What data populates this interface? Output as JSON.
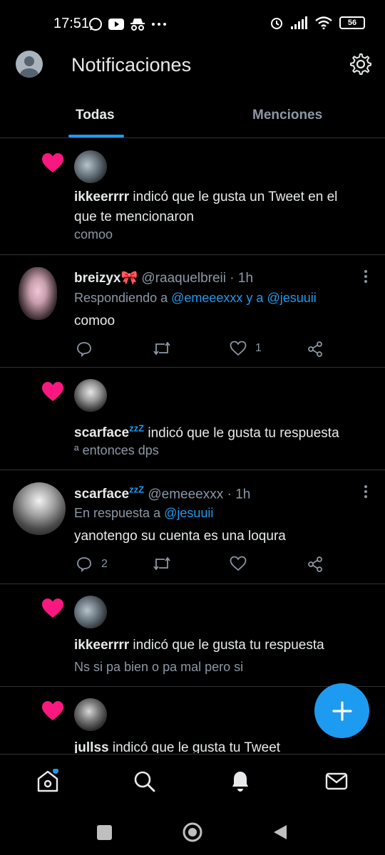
{
  "status": {
    "time": "17:51",
    "battery": "56"
  },
  "header": {
    "title": "Notificaciones"
  },
  "tabs": {
    "all": "Todas",
    "mentions": "Menciones"
  },
  "notifications": [
    {
      "type": "like",
      "user": "ikkeerrrr",
      "action": " indicó que le gusta un Tweet en el que te mencionaron",
      "snippet": "comoo"
    },
    {
      "type": "tweet",
      "name": "breizyx🎀",
      "handle": "@raaquelbreii · 1h",
      "reply_prefix": "Respondiendo a ",
      "reply_user1": "@emeeexxx",
      "reply_and": " y a ",
      "reply_user2": "@jesuuii",
      "text": "comoo",
      "likes": "1"
    },
    {
      "type": "like",
      "user": "scarface",
      "user_zz": "zzZ",
      "action": " indicó que le gusta tu respuesta",
      "snippet": "ª entonces dps"
    },
    {
      "type": "tweet",
      "name": "scarface",
      "name_zz": "zzZ",
      "handle": "@emeeexxx · 1h",
      "reply_prefix": "En respuesta a ",
      "reply_user1": "@jesuuii",
      "text": "yanotengo su cuenta es una loqura",
      "replies": "2"
    },
    {
      "type": "like",
      "user": "ikkeerrrr",
      "action": " indicó que le gusta tu respuesta",
      "snippet": "Ns si pa bien o pa mal pero si"
    },
    {
      "type": "like",
      "user": "jullss",
      "action": " indicó que le gusta tu Tweet"
    }
  ],
  "colors": {
    "accent": "#1d9bf0",
    "heart": "#f91880",
    "muted": "#8b98a5",
    "text": "#e7e9ea"
  }
}
